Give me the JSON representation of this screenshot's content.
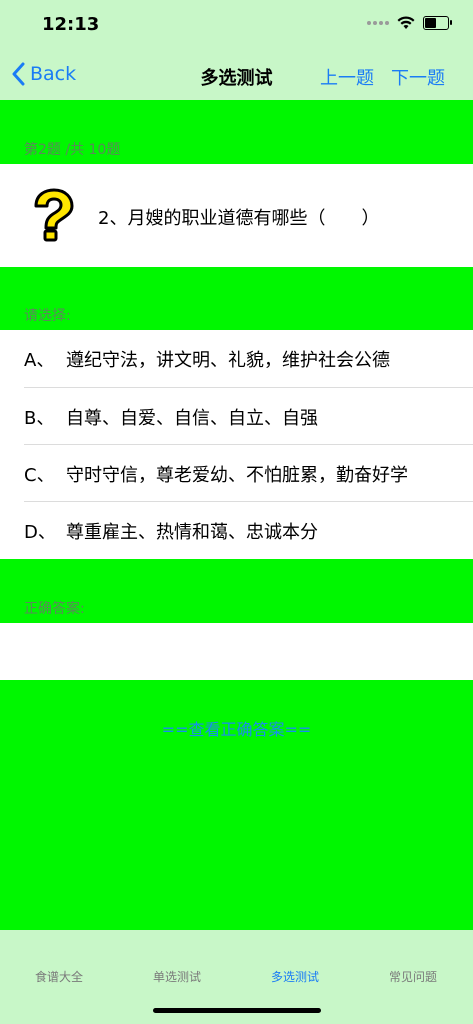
{
  "status": {
    "time": "12:13"
  },
  "nav": {
    "back_label": "Back",
    "title": "多选测试",
    "prev_label": "上一题",
    "next_label": "下一题"
  },
  "question": {
    "progress": "第2题 /共 10题",
    "text": "2、月嫂的职业道德有哪些（　　）",
    "icon": "question-mark-icon"
  },
  "options_label": "请选择:",
  "options": [
    {
      "letter": "A、",
      "text": "遵纪守法，讲文明、礼貌，维护社会公德"
    },
    {
      "letter": "B、",
      "text": "自尊、自爱、自信、自立、自强"
    },
    {
      "letter": "C、",
      "text": "守时守信，尊老爱幼、不怕脏累，勤奋好学"
    },
    {
      "letter": "D、",
      "text": "尊重雇主、热情和蔼、忠诚本分"
    }
  ],
  "answer_label": "正确答案:",
  "answer_value": "",
  "show_answer_label": "==查看正确答案==",
  "tabs": [
    {
      "label": "食谱大全",
      "active": false
    },
    {
      "label": "单选测试",
      "active": false
    },
    {
      "label": "多选测试",
      "active": true
    },
    {
      "label": "常见问题",
      "active": false
    }
  ],
  "colors": {
    "accent": "#1a7cf5",
    "background": "#00f700",
    "bars": "#c8f7c8"
  }
}
